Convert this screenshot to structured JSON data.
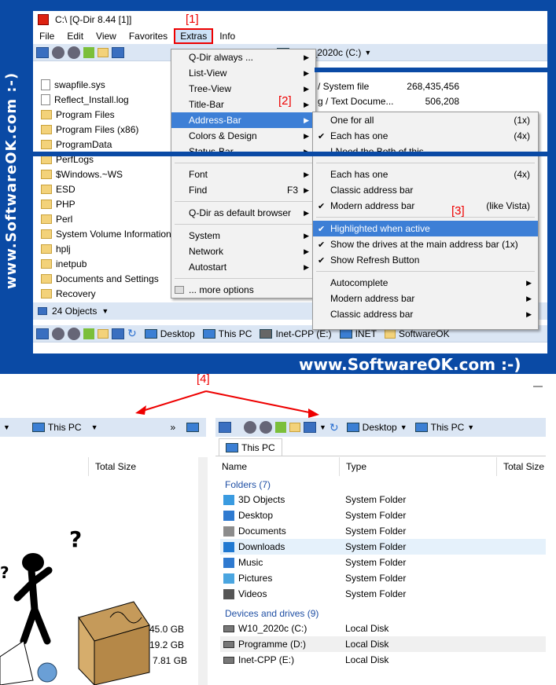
{
  "watermark_side": "www.SoftwareOK.com :-)",
  "watermark_mid": "www.SoftwareOK.com :-)",
  "window": {
    "title": "C:\\  [Q-Dir 8.44 [1]]"
  },
  "menubar": [
    "File",
    "Edit",
    "View",
    "Favorites",
    "Extras",
    "Info"
  ],
  "labels": {
    "l1": "[1]",
    "l2": "[2]",
    "l3": "[3]",
    "l4": "[4]"
  },
  "toolbar_top": {
    "drive": "W10_2020c (C:)"
  },
  "file_list": [
    {
      "name": "swapfile.sys",
      "type": "file"
    },
    {
      "name": "Reflect_Install.log",
      "type": "file"
    },
    {
      "name": "Program Files",
      "type": "folder"
    },
    {
      "name": "Program Files (x86)",
      "type": "folder"
    },
    {
      "name": "ProgramData",
      "type": "folder"
    },
    {
      "name": "PerfLogs",
      "type": "folder"
    },
    {
      "name": "$Windows.~WS",
      "type": "folder"
    },
    {
      "name": "ESD",
      "type": "folder"
    },
    {
      "name": "PHP",
      "type": "folder"
    },
    {
      "name": "Perl",
      "type": "folder"
    },
    {
      "name": "System Volume Information",
      "type": "folder"
    },
    {
      "name": "hplj",
      "type": "folder"
    },
    {
      "name": "inetpub",
      "type": "folder"
    },
    {
      "name": "Documents and Settings",
      "type": "link"
    },
    {
      "name": "Recovery",
      "type": "folder"
    }
  ],
  "file_details": [
    {
      "type": "/ System file",
      "size": "268,435,456"
    },
    {
      "type": "g / Text Docume...",
      "size": "506,208"
    }
  ],
  "status": {
    "objects": "24 Objects"
  },
  "extras_menu": [
    {
      "label": "Q-Dir always ...",
      "arrow": true
    },
    {
      "label": "List-View",
      "arrow": true
    },
    {
      "label": "Tree-View",
      "arrow": true
    },
    {
      "label": "Title-Bar",
      "arrow": true
    },
    {
      "label": "Address-Bar",
      "arrow": true,
      "highlight": true
    },
    {
      "label": "Colors & Design",
      "arrow": true
    },
    {
      "label": "Status-Bar",
      "arrow": true
    },
    {
      "label": "Font",
      "arrow": true
    },
    {
      "label": "Find",
      "shortcut": "F3",
      "arrow": true
    },
    {
      "label": "Q-Dir as default browser",
      "arrow": true
    },
    {
      "label": "System",
      "arrow": true
    },
    {
      "label": "Network",
      "arrow": true
    },
    {
      "label": "Autostart",
      "arrow": true
    },
    {
      "label": "... more options"
    }
  ],
  "address_menu": [
    {
      "label": "One for all",
      "right": "(1x)"
    },
    {
      "label": "Each has one",
      "right": "(4x)",
      "check": true
    },
    {
      "label": "I Need the Both of this"
    },
    {
      "label": "Each has one",
      "right": "(4x)"
    },
    {
      "label": "Classic address bar"
    },
    {
      "label": "Modern address bar",
      "right": "(like Vista)",
      "check": true
    },
    {
      "label": "Highlighted when active",
      "check": true,
      "highlight": true
    },
    {
      "label": "Show the drives at the main address bar (1x)",
      "check": true
    },
    {
      "label": "Show Refresh Button",
      "check": true
    },
    {
      "label": "Autocomplete",
      "arrow": true
    },
    {
      "label": "Modern address bar",
      "arrow": true
    },
    {
      "label": "Classic address bar",
      "arrow": true
    }
  ],
  "toolbar_bottom": {
    "items": [
      "Desktop",
      "This PC",
      "Inet-CPP (E:)",
      "INET",
      "SoftwareOK"
    ]
  },
  "bottom_left": {
    "breadcrumb": "This PC",
    "col": "Total Size",
    "sizes": [
      "45.0 GB",
      "19.2 GB",
      "7.81 GB"
    ]
  },
  "bottom_right": {
    "breadcrumb": [
      "Desktop",
      "This PC"
    ],
    "tab": "This PC",
    "cols": [
      "Name",
      "Type",
      "Total Size"
    ],
    "group1": "Folders (7)",
    "folders": [
      {
        "name": "3D Objects",
        "type": "System Folder",
        "color": "#3a9be0"
      },
      {
        "name": "Desktop",
        "type": "System Folder",
        "color": "#2f7ad0"
      },
      {
        "name": "Documents",
        "type": "System Folder",
        "color": "#8c8c8c"
      },
      {
        "name": "Downloads",
        "type": "System Folder",
        "color": "#1f78d1"
      },
      {
        "name": "Music",
        "type": "System Folder",
        "color": "#2f7ad0"
      },
      {
        "name": "Pictures",
        "type": "System Folder",
        "color": "#4aa5e0"
      },
      {
        "name": "Videos",
        "type": "System Folder",
        "color": "#555555"
      }
    ],
    "group2": "Devices and drives (9)",
    "drives": [
      {
        "name": "W10_2020c (C:)",
        "type": "Local Disk"
      },
      {
        "name": "Programme (D:)",
        "type": "Local Disk"
      },
      {
        "name": "Inet-CPP (E:)",
        "type": "Local Disk"
      }
    ]
  }
}
